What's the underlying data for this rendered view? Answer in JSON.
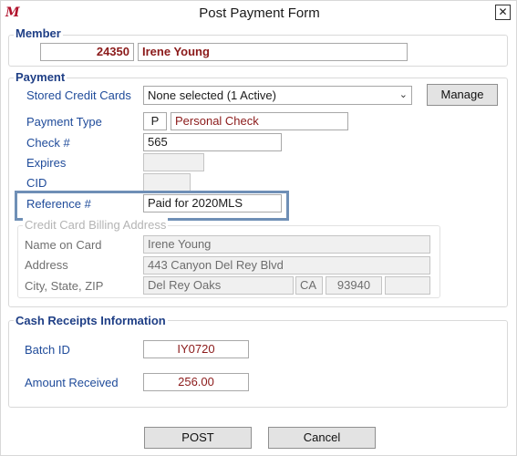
{
  "window": {
    "title": "Post Payment Form",
    "close_symbol": "✕"
  },
  "member": {
    "legend": "Member",
    "id": "24350",
    "name": "Irene Young"
  },
  "payment": {
    "legend": "Payment",
    "stored_cards_label": "Stored Credit Cards",
    "stored_cards_value": "None selected (1 Active)",
    "manage_label": "Manage",
    "payment_type_label": "Payment Type",
    "payment_type_code": "P",
    "payment_type_name": "Personal Check",
    "check_label": "Check #",
    "check_value": "565",
    "expires_label": "Expires",
    "expires_value": "",
    "cid_label": "CID",
    "cid_value": "",
    "reference_label": "Reference #",
    "reference_value": "Paid for 2020MLS"
  },
  "billing": {
    "legend": "Credit Card Billing Address",
    "name_label": "Name on Card",
    "name_value": "Irene Young",
    "address_label": "Address",
    "address_value": "443 Canyon Del Rey Blvd",
    "city_label": "City, State, ZIP",
    "city_value": "Del Rey Oaks",
    "state_value": "CA",
    "zip_value": "93940",
    "zip_ext_value": ""
  },
  "cash_receipts": {
    "legend": "Cash Receipts Information",
    "batch_label": "Batch ID",
    "batch_value": "IY0720",
    "amount_label": "Amount Received",
    "amount_value": "256.00"
  },
  "footer": {
    "post_label": "POST",
    "cancel_label": "Cancel"
  },
  "colors": {
    "label_blue": "#1f4b9a",
    "value_red": "#8b1a1a",
    "highlight_border": "#6f8fb6"
  }
}
